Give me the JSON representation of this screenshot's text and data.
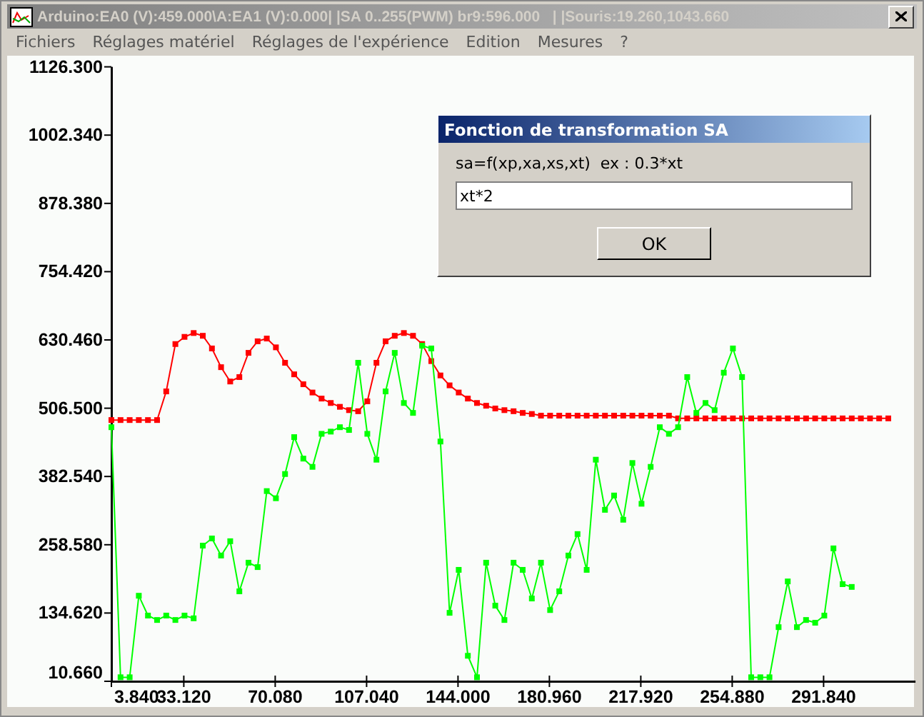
{
  "window": {
    "title": "Arduino:EA0 (V):459.000\\A:EA1 (V):0.000| |SA 0..255(PWM) br9:596.000   | |Souris:19.260,1043.660"
  },
  "menu": [
    "Fichiers",
    "Réglages matériel",
    "Réglages de l'expérience",
    "Edition",
    "Mesures",
    "?"
  ],
  "chart": {
    "chart_data": {
      "type": "line",
      "x": [
        3.84,
        7.536,
        11.232,
        14.928,
        18.624,
        22.32,
        26.016,
        29.712,
        33.408,
        37.104,
        40.8,
        44.496,
        48.192,
        51.888,
        55.584,
        59.28,
        62.976,
        66.672,
        70.368,
        74.064,
        77.76,
        81.456,
        85.152,
        88.848,
        92.544,
        96.24,
        99.936,
        103.632,
        107.328,
        111.024,
        114.72,
        118.416,
        122.112,
        125.808,
        129.504,
        133.2,
        136.896,
        140.592,
        144.288,
        147.984,
        151.68,
        155.376,
        159.072,
        162.768,
        166.464,
        170.16,
        173.856,
        177.552,
        181.248,
        184.944,
        188.64,
        192.336,
        196.032,
        199.728,
        203.424,
        207.12,
        210.816,
        214.512,
        218.208,
        221.904,
        225.6,
        229.296,
        232.992,
        236.688,
        240.384,
        244.08,
        247.776,
        251.472,
        255.168,
        258.864,
        262.56,
        266.256,
        269.952,
        273.648,
        277.344,
        281.04,
        284.736,
        288.432,
        292.128,
        295.824,
        299.52,
        303.216,
        306.912,
        310.608,
        314.304,
        318.0
      ],
      "series": [
        {
          "color": "#ff0000",
          "marker": "square",
          "values": [
            485,
            485,
            485,
            485,
            485,
            485,
            537,
            623,
            636,
            643,
            638,
            615,
            581,
            555,
            563,
            607,
            628,
            633,
            617,
            589,
            568,
            550,
            535,
            524,
            516,
            509,
            503,
            501,
            519,
            589,
            628,
            638,
            643,
            638,
            623,
            592,
            566,
            548,
            535,
            524,
            516,
            511,
            506,
            503,
            501,
            498,
            496,
            493,
            493,
            493,
            493,
            493,
            493,
            493,
            493,
            493,
            493,
            493,
            493,
            493,
            493,
            493,
            488,
            488,
            488,
            488,
            488,
            488,
            488,
            488,
            488,
            488,
            488,
            488,
            488,
            488,
            488,
            488,
            488,
            488,
            488,
            488,
            488,
            488,
            488,
            488
          ]
        },
        {
          "color": "#00ff00",
          "marker": "square",
          "values": [
            472,
            18,
            18,
            166,
            130,
            122,
            130,
            122,
            130,
            125,
            257,
            270,
            239,
            265,
            174,
            226,
            218,
            356,
            343,
            387,
            454,
            415,
            400,
            460,
            464,
            472,
            467,
            589,
            460,
            413,
            537,
            607,
            516,
            498,
            620,
            615,
            446,
            135,
            213,
            57,
            18,
            226,
            148,
            122,
            226,
            213,
            161,
            226,
            140,
            174,
            239,
            278,
            213,
            413,
            322,
            348,
            304,
            407,
            333,
            400,
            472,
            460,
            472,
            563,
            498,
            516,
            503,
            571,
            615,
            563,
            18,
            18,
            18,
            109,
            192,
            109,
            122,
            117,
            130,
            252,
            187,
            182,
            null,
            null,
            null,
            null
          ]
        }
      ],
      "xlim": [
        3.84,
        329
      ],
      "ylim": [
        10.66,
        1126.3
      ],
      "xticks": [
        {
          "value": 3.84,
          "label": "3.840"
        },
        {
          "value": 33.12,
          "label": "33.120"
        },
        {
          "value": 70.08,
          "label": "70.080"
        },
        {
          "value": 107.04,
          "label": "107.040"
        },
        {
          "value": 144,
          "label": "144.000"
        },
        {
          "value": 180.96,
          "label": "180.960"
        },
        {
          "value": 217.92,
          "label": "217.920"
        },
        {
          "value": 254.88,
          "label": "254.880"
        },
        {
          "value": 291.84,
          "label": "291.840"
        }
      ],
      "yticks": [
        {
          "value": 10.66,
          "label": "10.660"
        },
        {
          "value": 134.62,
          "label": "134.620"
        },
        {
          "value": 258.58,
          "label": "258.580"
        },
        {
          "value": 382.54,
          "label": "382.540"
        },
        {
          "value": 506.5,
          "label": "506.500"
        },
        {
          "value": 630.46,
          "label": "630.460"
        },
        {
          "value": 754.42,
          "label": "754.420"
        },
        {
          "value": 878.38,
          "label": "878.380"
        },
        {
          "value": 1002.34,
          "label": "1002.340"
        },
        {
          "value": 1126.3,
          "label": "1126.300"
        }
      ]
    }
  },
  "dialog": {
    "title": "Fonction de transformation SA",
    "prompt": "sa=f(xp,xa,xs,xt)  ex : 0.3*xt",
    "input": {
      "value": "xt*2"
    },
    "button": "OK"
  }
}
